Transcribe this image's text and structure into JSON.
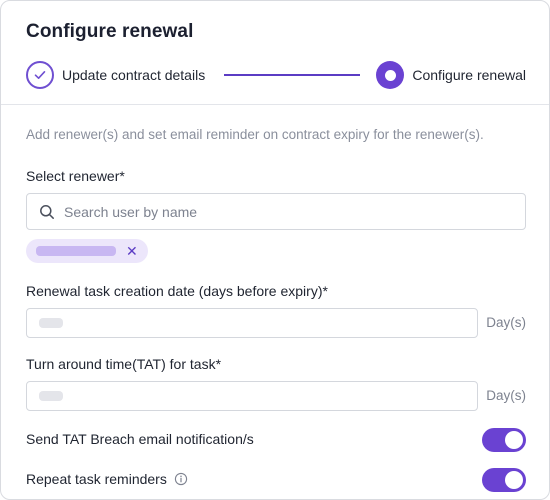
{
  "header": {
    "title": "Configure renewal",
    "steps": [
      {
        "label": "Update contract details",
        "status": "completed"
      },
      {
        "label": "Configure renewal",
        "status": "active"
      }
    ]
  },
  "form": {
    "helper_text": "Add renewer(s) and set email reminder on contract expiry for the renewer(s).",
    "renewer": {
      "label": "Select renewer*",
      "search_placeholder": "Search user by name",
      "search_icon": "search-icon",
      "chip_remove_icon": "close-icon"
    },
    "renewal_task_days": {
      "label": "Renewal task creation date (days before expiry)*",
      "unit": "Day(s)"
    },
    "tat": {
      "label": "Turn around time(TAT) for task*",
      "unit": "Day(s)"
    },
    "toggles": [
      {
        "label": "Send TAT Breach email notification/s",
        "on": true,
        "info": false
      },
      {
        "label": "Repeat task reminders",
        "on": true,
        "info": true
      }
    ]
  },
  "colors": {
    "accent": "#6a42d2",
    "chip_bg": "#ece6fb",
    "border": "#d4d7dd"
  }
}
